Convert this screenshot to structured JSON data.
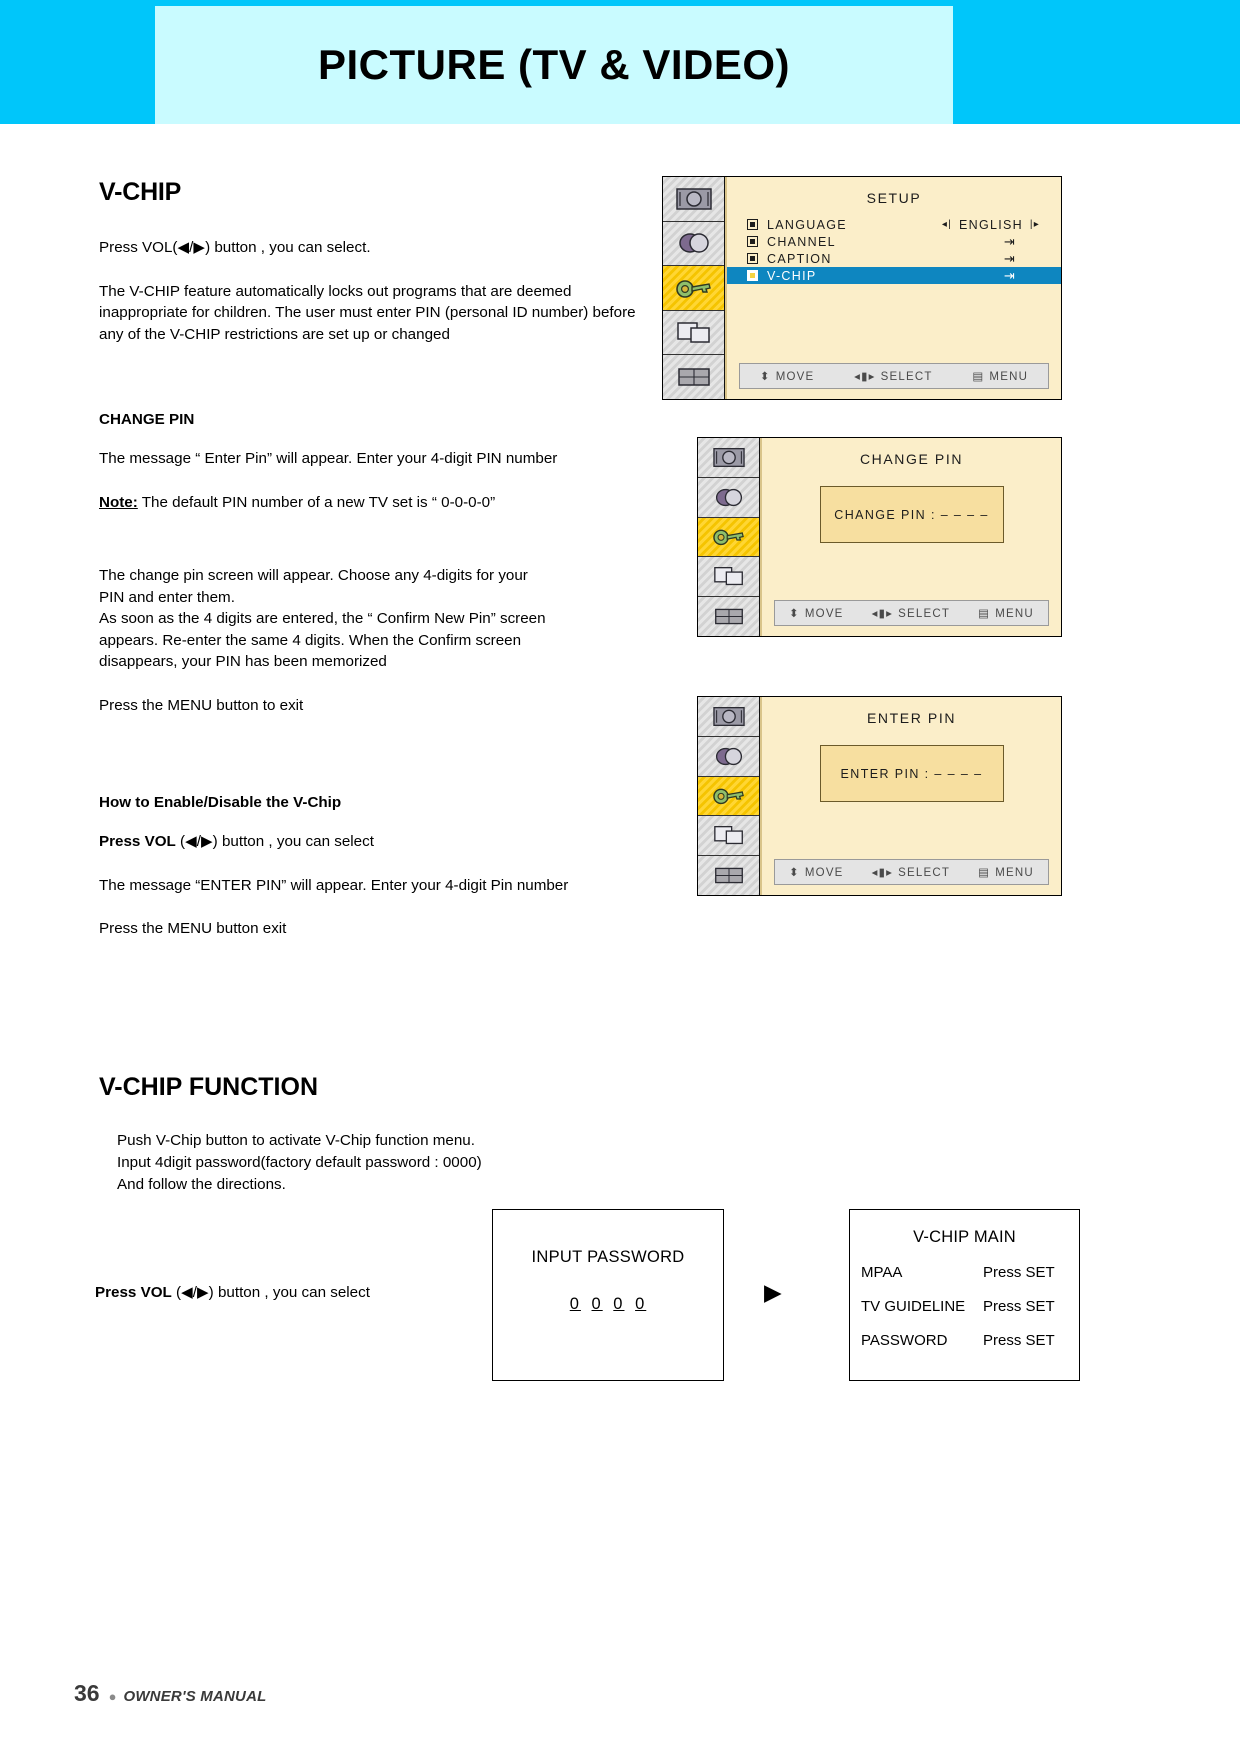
{
  "header": {
    "title": "PICTURE (TV & VIDEO)",
    "band_color": "#00c6fa",
    "panel_color": "#c9fbff"
  },
  "left_column": {
    "heading": "V-CHIP",
    "press_vol_line": "Press  VOL(◀/▶) button , you can select.",
    "intro_paragraph": "The V-CHIP feature automatically locks out programs that are deemed inappropriate for children. The user must enter PIN (personal ID number) before any of the V-CHIP restrictions are set up or changed",
    "change_pin_heading": "CHANGE PIN",
    "change_pin_message": "The message “ Enter Pin” will appear. Enter your 4-digit PIN number",
    "note_label": "Note:",
    "note_text": " The default PIN number of a new TV set is “ 0-0-0-0”",
    "change_pin_detail": "The change pin screen will appear. Choose any 4-digits for your PIN and enter them.\nAs soon as the 4 digits are entered, the “ Confirm New Pin” screen appears. Re-enter the same 4 digits. When the Confirm screen disappears, your PIN has been memorized",
    "change_pin_detail_l1": "The change pin screen will appear. Choose any 4-digits for your",
    "change_pin_detail_l2": "PIN and enter them.",
    "change_pin_detail_l3": "As soon as the 4 digits are entered, the “ Confirm New Pin” screen",
    "change_pin_detail_l4": "appears. Re-enter the same 4 digits. When the Confirm screen",
    "change_pin_detail_l5": "disappears, your PIN has been memorized",
    "press_menu_exit_1": "Press the MENU button to exit",
    "enable_disable_heading": "How to Enable/Disable the V-Chip",
    "press_vol_bold": "Press VOL",
    "press_vol_rest": " (◀/▶) button , you can select",
    "enter_pin_message": "The message “ENTER PIN” will appear. Enter your 4-digit Pin number",
    "press_menu_exit_2": "Press the MENU button exit"
  },
  "vchip_function": {
    "heading": "V-CHIP FUNCTION",
    "line1": "Push V-Chip button to activate V-Chip function menu.",
    "line2": "Input 4digit password(factory default password : 0000)",
    "line3": "And follow the directions.",
    "press_vol_bold": "Press VOL",
    "press_vol_rest": " (◀/▶) button , you can select"
  },
  "osd_setup": {
    "title": "SETUP",
    "rows": [
      {
        "label": "LANGUAGE",
        "value": "ENGLISH",
        "type": "value",
        "selected": false
      },
      {
        "label": "CHANNEL",
        "value": "",
        "type": "enter",
        "selected": false
      },
      {
        "label": "CAPTION",
        "value": "",
        "type": "enter",
        "selected": false
      },
      {
        "label": "V-CHIP",
        "value": "",
        "type": "enter",
        "selected": true
      }
    ],
    "bar": {
      "move": "MOVE",
      "select": "SELECT",
      "menu": "MENU"
    },
    "highlight_color": "#0e86c0",
    "panel_color": "#fbeec9"
  },
  "osd_change_pin": {
    "title": "CHANGE PIN",
    "field": "CHANGE PIN : – – – –",
    "bar": {
      "move": "MOVE",
      "select": "SELECT",
      "menu": "MENU"
    }
  },
  "osd_enter_pin": {
    "title": "ENTER PIN",
    "field": "ENTER PIN : – – – –",
    "bar": {
      "move": "MOVE",
      "select": "SELECT",
      "menu": "MENU"
    }
  },
  "diagram": {
    "input_password": {
      "title": "INPUT PASSWORD",
      "digits": [
        "0",
        "0",
        "0",
        "0"
      ]
    },
    "flow_arrow": "▶",
    "vchip_main": {
      "title": "V-CHIP MAIN",
      "rows": [
        {
          "key": "MPAA",
          "value": "Press SET"
        },
        {
          "key": "TV GUIDELINE",
          "value": "Press SET"
        },
        {
          "key": "PASSWORD",
          "value": "Press SET"
        }
      ]
    }
  },
  "footer": {
    "page": "36",
    "dot": "●",
    "text": "OWNER'S MANUAL"
  }
}
